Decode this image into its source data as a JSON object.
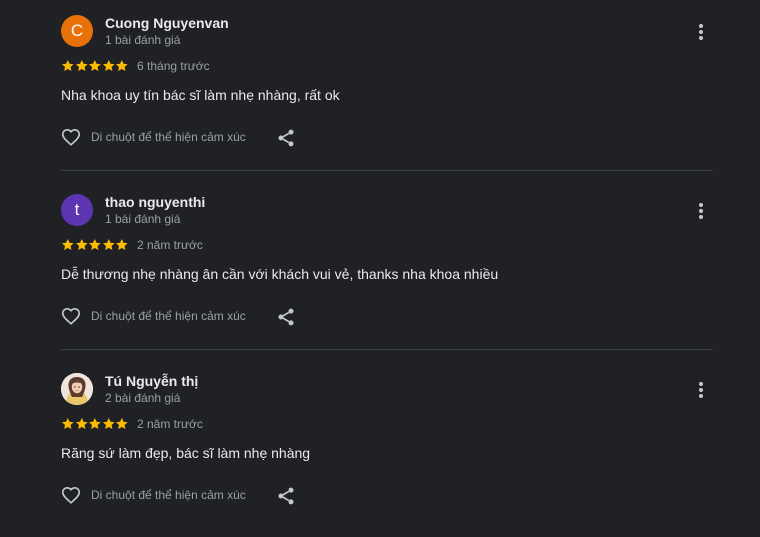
{
  "reviews": [
    {
      "avatar_letter": "C",
      "avatar_color": "#e8710a",
      "name": "Cuong Nguyenvan",
      "review_count": "1 bài đánh giá",
      "rating": 5,
      "time": "6 tháng trước",
      "text": "Nha khoa uy tín bác sĩ làm nhẹ nhàng, rất ok",
      "reaction_label": "Di chuột để thể hiện cảm xúc"
    },
    {
      "avatar_letter": "t",
      "avatar_color": "#5e35b1",
      "name": "thao nguyenthi",
      "review_count": "1 bài đánh giá",
      "rating": 5,
      "time": "2 năm trước",
      "text": "Dễ thương nhẹ nhàng ân cần với khách vui vẻ, thanks nha khoa nhiều",
      "reaction_label": "Di chuột để thể hiện cảm xúc"
    },
    {
      "avatar_letter": "",
      "avatar_color": "#f3e3d8",
      "name": "Tú Nguyễn thị",
      "review_count": "2 bài đánh giá",
      "rating": 5,
      "time": "2 năm trước",
      "text": "Răng sứ làm đẹp, bác sĩ làm nhẹ nhàng",
      "reaction_label": "Di chuột để thể hiện cảm xúc"
    }
  ],
  "colors": {
    "background": "#202124",
    "star": "#fbbc04",
    "primary_text": "#e8eaed",
    "secondary_text": "#9aa0a6",
    "icon": "#c5c8cc",
    "divider": "#3c4043"
  },
  "icons": {
    "more": "more-vert-icon",
    "like": "heart-outline-icon",
    "share": "share-icon",
    "star": "star-icon"
  }
}
